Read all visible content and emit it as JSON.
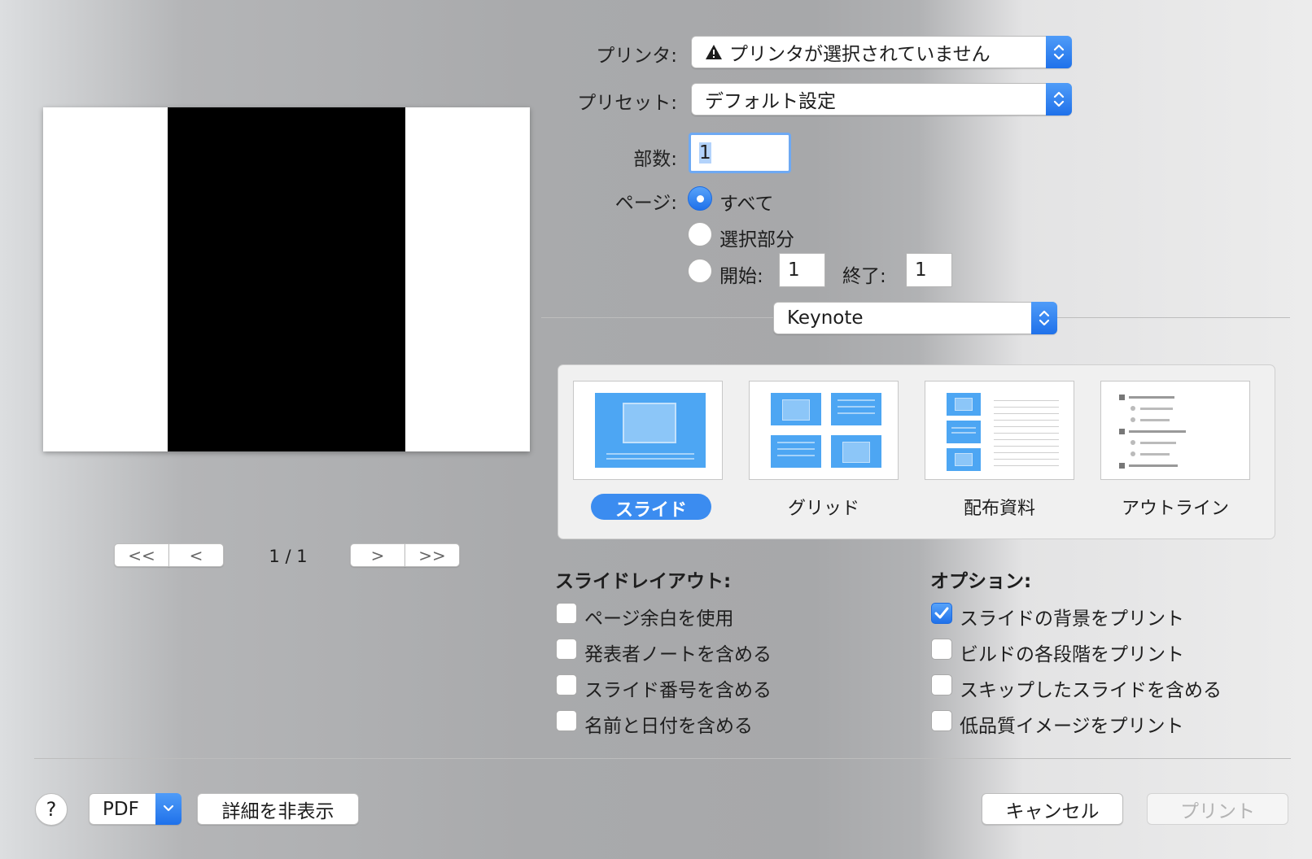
{
  "printer": {
    "label": "プリンタ:",
    "value": "プリンタが選択されていません",
    "warning_icon": "warning-icon"
  },
  "preset": {
    "label": "プリセット:",
    "value": "デフォルト設定"
  },
  "copies": {
    "label": "部数:",
    "value": "1"
  },
  "pages": {
    "label": "ページ:",
    "options": [
      "すべて",
      "選択部分",
      "開始:"
    ],
    "selected": "すべて",
    "to_label": "終了:",
    "from_value": "1",
    "to_value": "1"
  },
  "app_menu": {
    "value": "Keynote"
  },
  "layout_types": {
    "items": [
      "スライド",
      "グリッド",
      "配布資料",
      "アウトライン"
    ],
    "selected": "スライド"
  },
  "slide_layout": {
    "title": "スライドレイアウト:",
    "items": [
      {
        "label": "ページ余白を使用",
        "checked": false
      },
      {
        "label": "発表者ノートを含める",
        "checked": false
      },
      {
        "label": "スライド番号を含める",
        "checked": false
      },
      {
        "label": "名前と日付を含める",
        "checked": false
      }
    ]
  },
  "options": {
    "title": "オプション:",
    "items": [
      {
        "label": "スライドの背景をプリント",
        "checked": true
      },
      {
        "label": "ビルドの各段階をプリント",
        "checked": false
      },
      {
        "label": "スキップしたスライドを含める",
        "checked": false
      },
      {
        "label": "低品質イメージをプリント",
        "checked": false
      }
    ]
  },
  "preview": {
    "page_indicator": "1 / 1"
  },
  "footer": {
    "help": "?",
    "pdf": "PDF",
    "hide_details": "詳細を非表示",
    "cancel": "キャンセル",
    "print": "プリント"
  },
  "colors": {
    "accent": "#1f71ea",
    "thumb_blue": "#4da6f3"
  }
}
